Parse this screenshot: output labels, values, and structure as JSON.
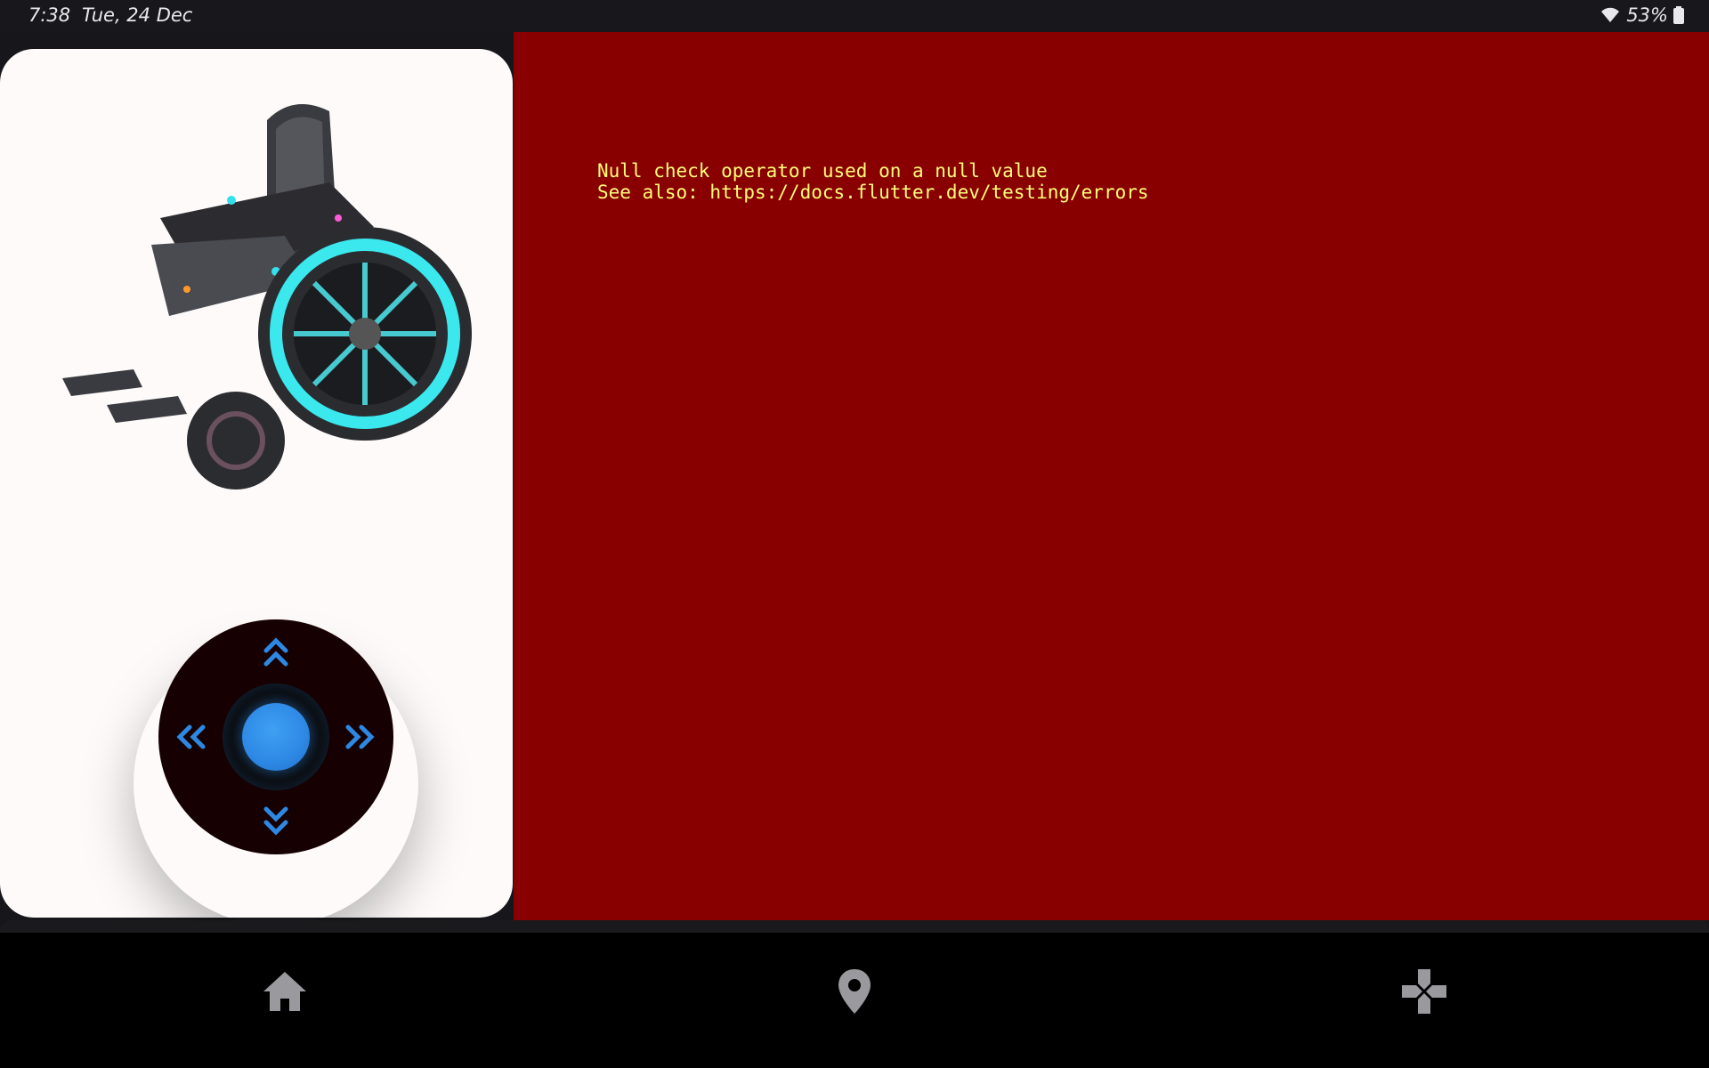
{
  "status_bar": {
    "time": "7:38",
    "date": "Tue, 24 Dec",
    "battery": "53%",
    "wifi_icon": "wifi-icon",
    "battery_icon": "battery-icon"
  },
  "left_panel": {
    "image": "wheelchair-image",
    "joystick": {
      "icons": {
        "up": "double-chevron-up-icon",
        "down": "double-chevron-down-icon",
        "left": "double-chevron-left-icon",
        "right": "double-chevron-right-icon"
      },
      "accent_color": "#2d88e4"
    }
  },
  "error": {
    "line1": "Null check operator used on a null value",
    "line2": "See also: https://docs.flutter.dev/testing/errors",
    "background": "#880000",
    "text_color": "#ffff7a"
  },
  "bottom_nav": {
    "items": [
      {
        "icon": "home-icon"
      },
      {
        "icon": "location-pin-icon"
      },
      {
        "icon": "gamepad-icon"
      }
    ]
  }
}
